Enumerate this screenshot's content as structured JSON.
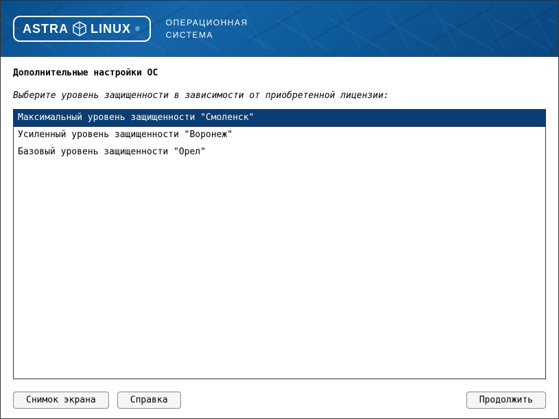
{
  "header": {
    "brand_part1": "ASTRA",
    "brand_part2": "LINUX",
    "subtitle_line1": "ОПЕРАЦИОННАЯ",
    "subtitle_line2": "СИСТЕМА"
  },
  "page": {
    "title": "Дополнительные настройки ОС",
    "instruction": "Выберите уровень защищенности в зависимости от приобретенной лицензии:"
  },
  "options": [
    {
      "label": "Максимальный уровень защищенности \"Смоленск\"",
      "selected": true
    },
    {
      "label": "Усиленный уровень защищенности \"Воронеж\"",
      "selected": false
    },
    {
      "label": "Базовый уровень защищенности \"Орел\"",
      "selected": false
    }
  ],
  "buttons": {
    "screenshot": "Снимок экрана",
    "help": "Справка",
    "continue": "Продолжить"
  },
  "colors": {
    "selection_bg": "#0a3d73",
    "header_bg": "#0d5a99"
  }
}
